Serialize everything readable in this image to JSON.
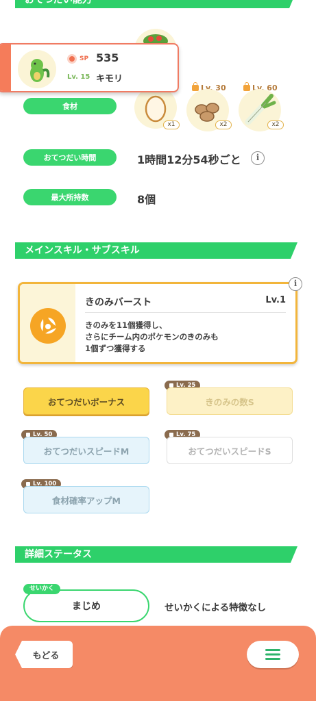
{
  "top_section": {
    "title": "おてつだい能力"
  },
  "pokemon_card": {
    "sp_label": "SP",
    "sp_value": "535",
    "level": "Lv. 15",
    "name": "キモリ"
  },
  "ingredients": {
    "label": "食材",
    "items": [
      {
        "name": "egg",
        "count": "x1",
        "unlock_level": ""
      },
      {
        "name": "nuts",
        "count": "x2",
        "unlock_level": "Lv. 30"
      },
      {
        "name": "leek",
        "count": "x2",
        "unlock_level": "Lv. 60"
      }
    ]
  },
  "help_time": {
    "label": "おてつだい時間",
    "value": "1時間12分54秒ごと"
  },
  "max_carry": {
    "label": "最大所持数",
    "value": "8個"
  },
  "skills_section": {
    "title": "メインスキル・サブスキル"
  },
  "main_skill": {
    "name": "きのみバースト",
    "level": "Lv.1",
    "description": "きのみを11個獲得し、\nさらにチーム内のポケモンのきのみも\n1個ずつ獲得する",
    "icon": "berry-burst-icon"
  },
  "sub_skills": [
    {
      "label": "おてつだいボーナス",
      "unlock_level": "",
      "state": "active"
    },
    {
      "label": "きのみの数S",
      "unlock_level": "Lv. 25",
      "state": "locked-yellow"
    },
    {
      "label": "おてつだいスピードM",
      "unlock_level": "Lv. 50",
      "state": "locked-blue"
    },
    {
      "label": "おてつだいスピードS",
      "unlock_level": "Lv. 75",
      "state": "locked-white"
    },
    {
      "label": "食材確率アップM",
      "unlock_level": "Lv. 100",
      "state": "locked-blue"
    }
  ],
  "detail_section": {
    "title": "詳細ステータス"
  },
  "nature": {
    "tag": "せいかく",
    "value": "まじめ",
    "effect": "せいかくによる特徴なし"
  },
  "footer": {
    "back_label": "もどる",
    "menu_icon": "hamburger-menu-icon"
  },
  "colors": {
    "accent_green": "#2ed06a",
    "accent_orange": "#f58a66",
    "skill_gold": "#f2b53b"
  }
}
